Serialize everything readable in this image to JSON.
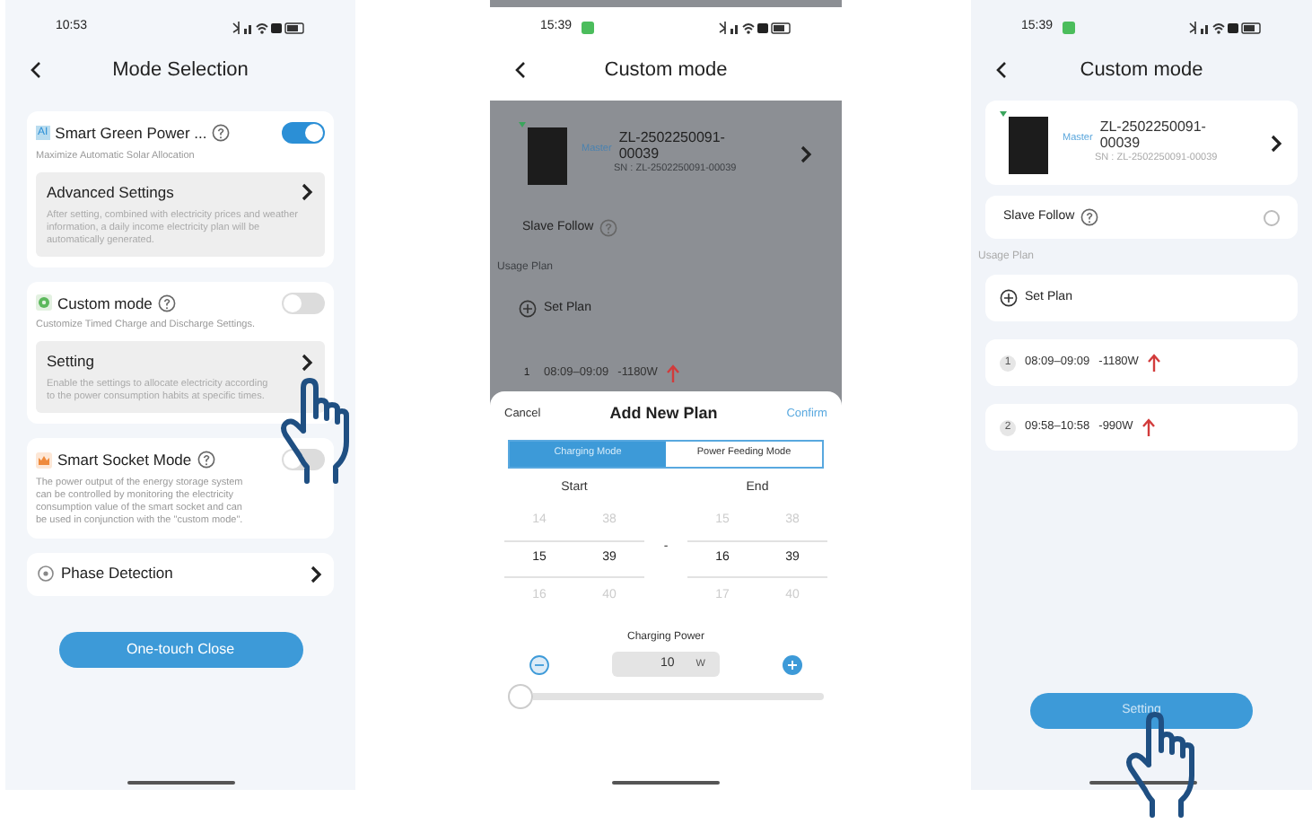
{
  "mode_selection_screen": {
    "status_time": "10:53",
    "title": "Mode Selection",
    "modes": [
      {
        "kind": "ai",
        "badge": "AI",
        "label": "Smart Green Power ...",
        "on": true,
        "description": "Maximize Automatic Solar Allocation",
        "setting": {
          "label": "Advanced Settings",
          "description": "After setting, combined with electricity prices and weather information, a daily income electricity plan will be automatically generated."
        }
      },
      {
        "kind": "gear",
        "label": "Custom mode",
        "on": false,
        "description": "Customize Timed Charge and Discharge Settings.",
        "setting": {
          "label": "Setting",
          "description": "Enable the settings to allocate electricity according to the power consumption habits at specific times."
        }
      },
      {
        "kind": "crown",
        "label": "Smart Socket Mode",
        "on": false,
        "description": "The power output of the energy storage system can be controlled by monitoring the electricity consumption value of the smart socket and can be used in conjunction with the \"custom mode\"."
      }
    ],
    "phase_detection": "Phase Detection",
    "button": "One-touch Close"
  },
  "add_plan_screen": {
    "status_time": "15:39",
    "title": "Custom mode",
    "device": {
      "role": "Master",
      "model": "ZL-2502250091-00039",
      "sn": "SN : ZL-2502250091-00039"
    },
    "slave_follow": "Slave Follow",
    "usage_plan": "Usage Plan",
    "set_plan": "Set Plan",
    "plans": [
      {
        "index": "1",
        "time": "08:09–09:09",
        "power": "-1180W"
      }
    ],
    "sheet": {
      "cancel": "Cancel",
      "title": "Add New Plan",
      "confirm": "Confirm",
      "segments": [
        {
          "label": "Charging Mode",
          "selected": true
        },
        {
          "label": "Power Feeding Mode",
          "selected": false
        }
      ],
      "start": {
        "label": "Start",
        "hours": [
          {
            "value": "14",
            "selected": false
          },
          {
            "value": "15",
            "selected": true
          },
          {
            "value": "16",
            "selected": false
          }
        ],
        "minutes": [
          {
            "value": "38",
            "selected": false
          },
          {
            "value": "39",
            "selected": true
          },
          {
            "value": "40",
            "selected": false
          }
        ]
      },
      "separator": "-",
      "end": {
        "label": "End",
        "hours": [
          {
            "value": "15",
            "selected": false
          },
          {
            "value": "16",
            "selected": true
          },
          {
            "value": "17",
            "selected": false
          }
        ],
        "minutes": [
          {
            "value": "38",
            "selected": false
          },
          {
            "value": "39",
            "selected": true
          },
          {
            "value": "40",
            "selected": false
          }
        ]
      },
      "power_label": "Charging Power",
      "power_value": "10",
      "power_unit": "W",
      "slider": {
        "level": 0
      }
    }
  },
  "custom_mode_screen": {
    "status_time": "15:39",
    "title": "Custom mode",
    "device": {
      "role": "Master",
      "model": "ZL-2502250091-00039",
      "sn": "SN : ZL-2502250091-00039"
    },
    "slave_follow": "Slave Follow",
    "slave_follow_checked": false,
    "usage_plan": "Usage Plan",
    "set_plan": "Set Plan",
    "plans": [
      {
        "index": "1",
        "time": "08:09–09:09",
        "power": "-1180W"
      },
      {
        "index": "2",
        "time": "09:58–10:58",
        "power": "-990W"
      }
    ],
    "button": "Setting"
  }
}
